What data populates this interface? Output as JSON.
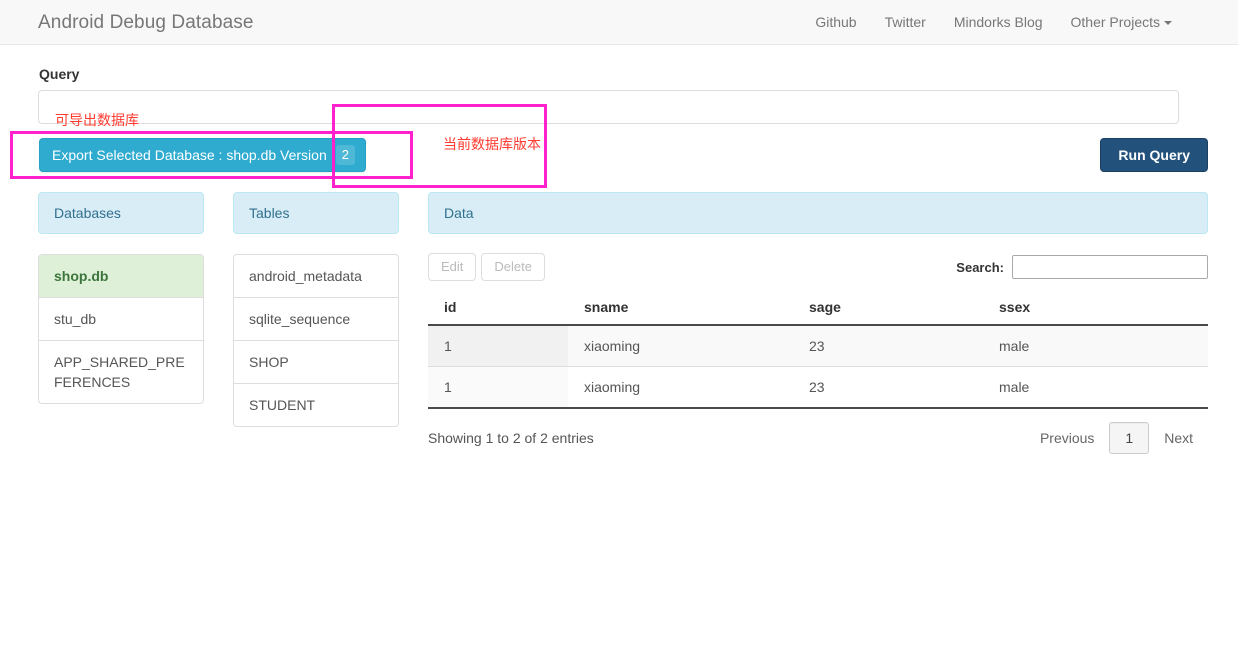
{
  "navbar": {
    "brand": "Android Debug Database",
    "links": [
      {
        "label": "Github"
      },
      {
        "label": "Twitter"
      },
      {
        "label": "Mindorks Blog"
      },
      {
        "label": "Other Projects"
      }
    ],
    "dropdown_caret_icon": "caret-down-icon"
  },
  "query": {
    "label": "Query",
    "value": "",
    "placeholder": ""
  },
  "actions": {
    "export_label": "Export Selected Database : shop.db Version",
    "export_version_badge": "2",
    "run_query_label": "Run Query"
  },
  "databases_panel": {
    "title": "Databases",
    "items": [
      {
        "label": "shop.db",
        "selected": true
      },
      {
        "label": "stu_db",
        "selected": false
      },
      {
        "label": "APP_SHARED_PREFERENCES",
        "selected": false
      }
    ]
  },
  "tables_panel": {
    "title": "Tables",
    "items": [
      {
        "label": "android_metadata"
      },
      {
        "label": "sqlite_sequence"
      },
      {
        "label": "SHOP"
      },
      {
        "label": "STUDENT"
      }
    ]
  },
  "data_panel": {
    "title": "Data",
    "edit_label": "Edit",
    "delete_label": "Delete",
    "search_label": "Search:",
    "search_value": "",
    "search_placeholder": "",
    "columns": [
      "id",
      "sname",
      "sage",
      "ssex"
    ],
    "rows": [
      [
        "1",
        "xiaoming",
        "23",
        "male"
      ],
      [
        "1",
        "xiaoming",
        "23",
        "male"
      ]
    ],
    "entries_info": "Showing 1 to 2 of 2 entries",
    "pagination": {
      "previous_label": "Previous",
      "current_page": "1",
      "next_label": "Next"
    }
  },
  "annotations": {
    "box_color": "#ff22cc",
    "text_color": "#ff3b30",
    "notes": [
      {
        "text": "可导出数据库"
      },
      {
        "text": "当前数据库版本"
      }
    ]
  }
}
